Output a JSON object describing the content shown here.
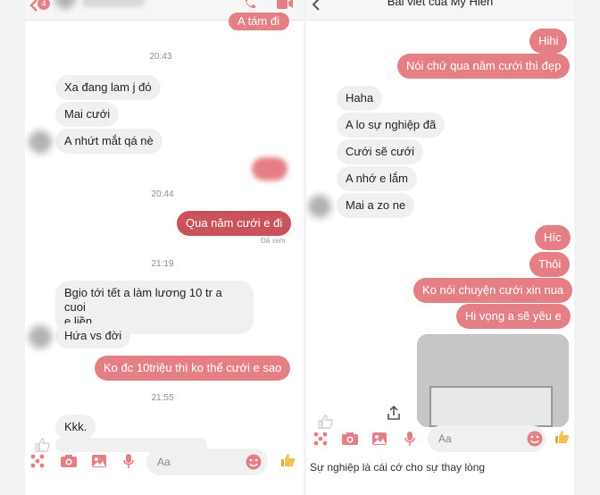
{
  "colors": {
    "accent": "#e57f86",
    "accent_dark": "#c9525c",
    "incoming_bg": "#f1f0f0",
    "outgoing_bg": "#e57f86"
  },
  "left": {
    "back_badge": "4",
    "top_outgoing": "A tám đi",
    "timestamps": [
      "20:43",
      "20:44",
      "21:19",
      "21:55"
    ],
    "group1": [
      "Xa đang lam j đó",
      "Mai cưới",
      "A nhứt mắt qá nè"
    ],
    "outgoing_1": "Qua năm cưới e đi",
    "seen": "Đã xem",
    "group2_line1": "Bgio tới tết a làm lương 10 tr a cuoi",
    "group2_line2": "e liền",
    "group2_2": "Hứa vs đời",
    "outgoing_2": "Ko đc 10triệu thì ko thể cưới e sao",
    "group3": "Kkk.",
    "composer_placeholder": "Aa"
  },
  "right": {
    "title": "Bài viết của Mỹ Hiền",
    "outgoing_top": [
      "Hihi",
      "Nói chứ qua năm cưới thì đẹp"
    ],
    "incoming": [
      "Haha",
      "A lo sự nghiệp đã",
      "Cưới sẽ cưới",
      "A nhớ e lắm",
      "Mai a zo ne"
    ],
    "outgoing_bottom": [
      "Híc",
      "Thôi",
      "Ko nói chuyện cưới xin nua",
      "Hi vọng a sẽ yêu e"
    ],
    "composer_placeholder": "Aa"
  },
  "caption": "Sự nghiệp là cái cớ cho sự thay lòng"
}
